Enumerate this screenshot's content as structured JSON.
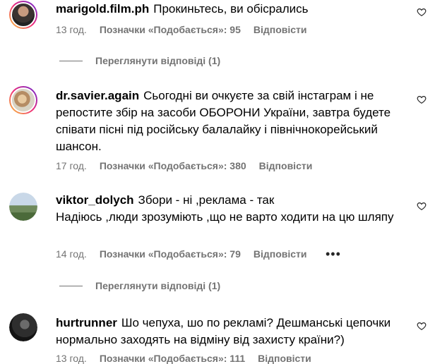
{
  "comments": [
    {
      "username": "marigold.film.ph",
      "text": "Прокиньтесь, ви обісрались",
      "time": "13 год.",
      "likes": "Позначки «Подобається»: 95",
      "reply": "Відповісти",
      "view_replies": "Переглянути відповіді (1)"
    },
    {
      "username": "dr.savier.again",
      "text": "Сьогодні ви очкуєте за свій інстаграм і не репостите збір на засоби ОБОРОНИ України, завтра будете співати пісні під російську балалайку і північнокорейський шансон.",
      "time": "17 год.",
      "likes": "Позначки «Подобається»: 380",
      "reply": "Відповісти"
    },
    {
      "username": "viktor_dolych",
      "text_line1": "Збори - ні ,реклама - так",
      "text_line2": "Надіюсь ,люди зрозуміють ,що не варто ходити на цю шляпу",
      "time": "14 год.",
      "likes": "Позначки «Подобається»: 79",
      "reply": "Відповісти",
      "more": "•••",
      "view_replies": "Переглянути відповіді (1)"
    },
    {
      "username": "hurtrunner",
      "text": "Шо чепуха, шо по рекламі? Дешманські цепочки нормально заходять на відміну від захисту країни?)",
      "time": "13 год.",
      "likes": "Позначки «Подобається»: 111",
      "reply": "Відповісти"
    }
  ],
  "icons": {
    "like": "heart-outline-icon",
    "more": "more-horizontal-icon"
  }
}
